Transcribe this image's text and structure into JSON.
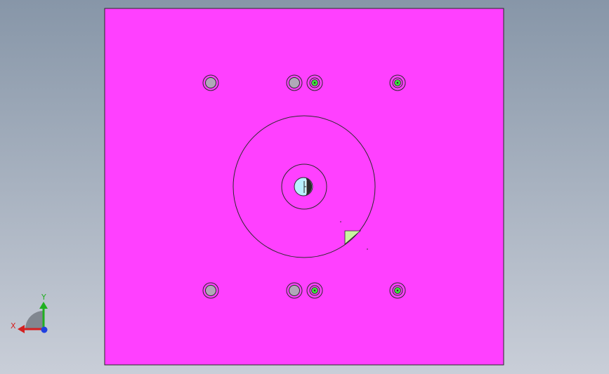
{
  "viewport": {
    "background_top": "#8796a8",
    "background_bottom": "#c9ced8"
  },
  "part": {
    "face_color": "#ff40ff",
    "edge_color": "#2a2a2a",
    "hole_fill_plain": "#b0a8b8",
    "hole_fill_tapped": "#3ddc3d",
    "center_bore_fill": "#b8f0ff",
    "corner_face_fill": "#c8f5a0"
  },
  "triad": {
    "x_label": "X",
    "y_label": "Y",
    "x_color": "#d42020",
    "y_color": "#20b020",
    "z_color": "#2040e0"
  }
}
